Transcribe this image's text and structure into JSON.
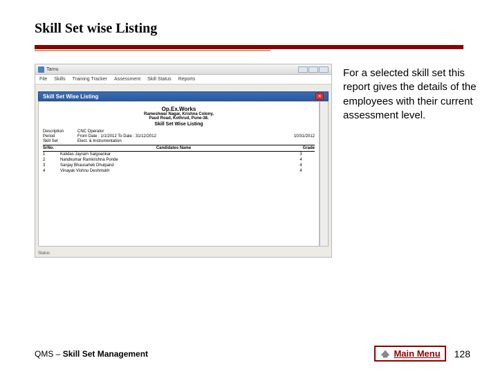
{
  "title": "Skill Set wise Listing",
  "description": "For a selected skill set this report gives the details of the employees with their current assessment level.",
  "footer": {
    "prefix": "QMS – ",
    "strong": "Skill Set Management",
    "main_menu": "Main Menu",
    "page": "128"
  },
  "screenshot": {
    "window_title": "Tarnu",
    "menus": [
      "File",
      "Skills",
      "Training Tracker",
      "Assessment",
      "Skill Status",
      "Reports"
    ],
    "sub_title": "Skill Set Wise Listing",
    "company": "Op.Ex.Works",
    "address1": "Rameshwar Nagar, Krishna Colony,",
    "address2": "Paud Road, Kothrud, Pune-38.",
    "report_title": "Skill Set Wise Listing",
    "meta": {
      "description_label": "Description",
      "description_value": "CNC Operator",
      "period_label": "Period",
      "period_value": "From Date : 1/1/2012 To Date : 31/12/2012",
      "skillset_label": "Skill Set",
      "skillset_value": "Elect. & Instrumentation",
      "date": "10/31/2012"
    },
    "columns": {
      "sr": "SrNo.",
      "name": "Candidates Name",
      "grade": "Grade"
    },
    "rows": [
      {
        "sr": "1",
        "name": "Kalidas Jayram Salgoankar",
        "grade": "3"
      },
      {
        "sr": "2",
        "name": "Nandkumar Ramkrishna Ponde",
        "grade": "4"
      },
      {
        "sr": "3",
        "name": "Sanjay Bhausaheb Dhulpand",
        "grade": "4"
      },
      {
        "sr": "4",
        "name": "Vinayak Vishnu Deshmukh",
        "grade": "4"
      }
    ],
    "status": "Status"
  }
}
